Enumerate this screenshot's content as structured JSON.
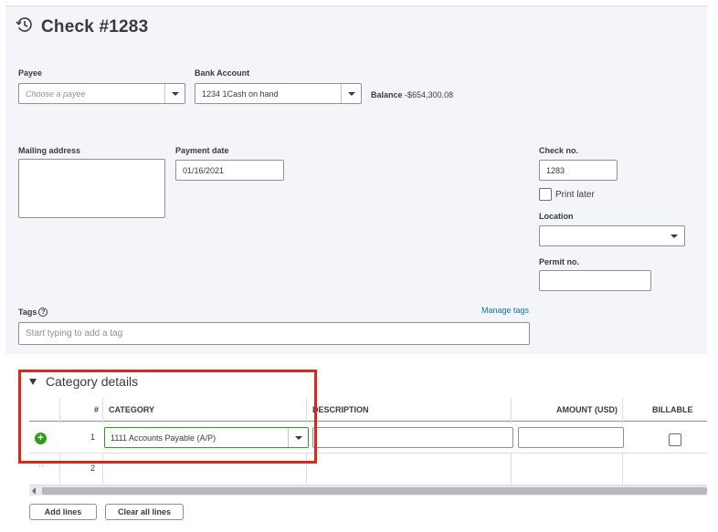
{
  "header": {
    "title": "Check #1283",
    "icon": "history-icon"
  },
  "payee": {
    "label": "Payee",
    "placeholder": "Choose a payee",
    "value": ""
  },
  "bank_account": {
    "label": "Bank Account",
    "value": "1234 1Cash on hand"
  },
  "balance": {
    "label": "Balance",
    "value": "-$654,300.08"
  },
  "mailing_address": {
    "label": "Mailing address",
    "value": ""
  },
  "payment_date": {
    "label": "Payment date",
    "value": "01/16/2021"
  },
  "check_no": {
    "label": "Check no.",
    "value": "1283"
  },
  "print_later": {
    "label": "Print later",
    "checked": false
  },
  "location": {
    "label": "Location",
    "value": ""
  },
  "permit_no": {
    "label": "Permit no.",
    "value": ""
  },
  "tags": {
    "label": "Tags",
    "help_icon": "?",
    "manage_link": "Manage tags",
    "placeholder": "Start typing to add a tag"
  },
  "category_details": {
    "title": "Category details",
    "columns": {
      "num": "#",
      "category": "CATEGORY",
      "description": "DESCRIPTION",
      "amount": "AMOUNT (USD)",
      "billable": "BILLABLE"
    },
    "rows": [
      {
        "num": "1",
        "category": "1111 Accounts Payable (A/P)",
        "description": "",
        "amount": "",
        "billable": false
      },
      {
        "num": "2",
        "category": "",
        "description": "",
        "amount": "",
        "billable": false
      }
    ],
    "add_icon": "+",
    "drag_icon": "⁝⁝"
  },
  "buttons": {
    "add_lines": "Add lines",
    "clear_all_lines": "Clear all lines"
  },
  "colors": {
    "accent_green": "#2ca01c",
    "link_blue": "#0077c5",
    "highlight_red": "#d52b1e"
  }
}
